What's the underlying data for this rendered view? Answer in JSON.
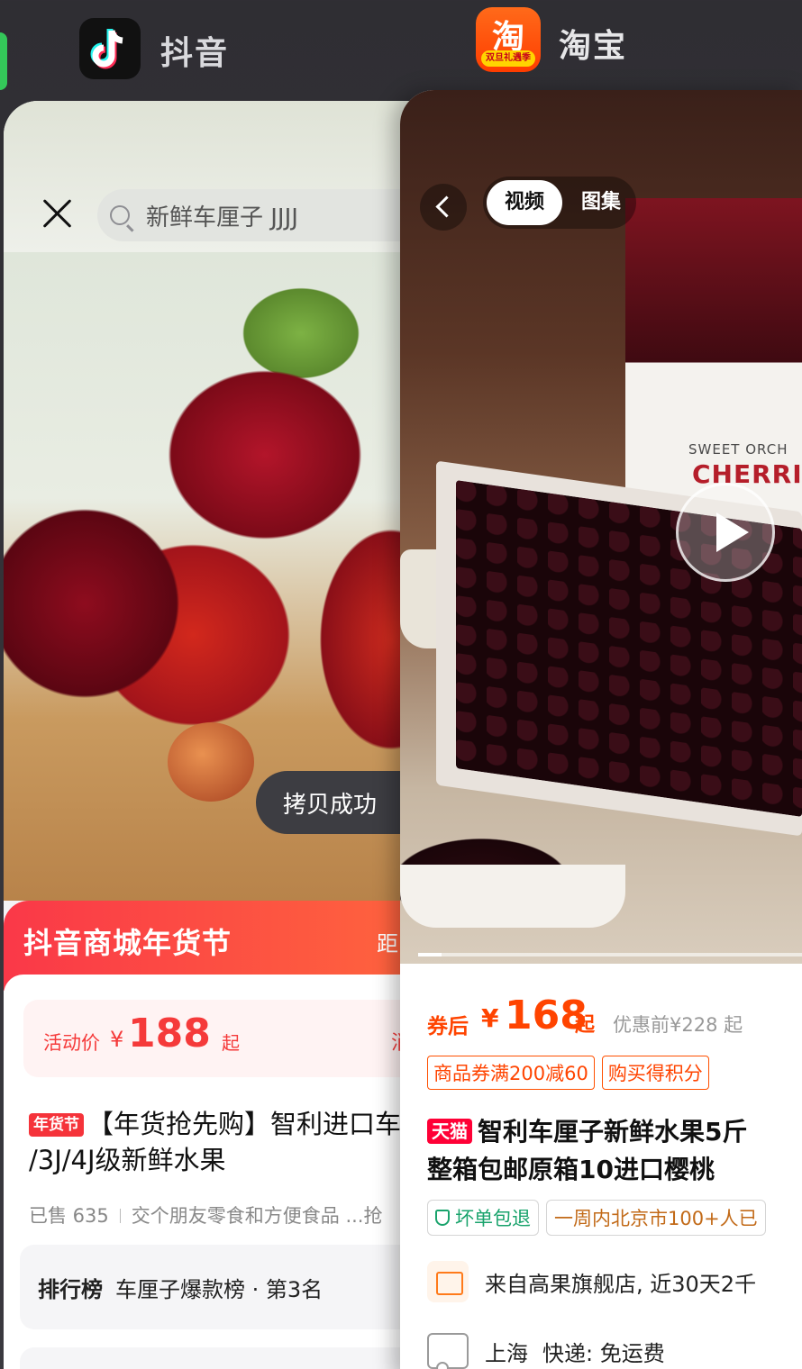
{
  "switcher": {
    "douyin": {
      "name": "抖音",
      "accent": "#fe2c55"
    },
    "taobao": {
      "name": "淘宝",
      "icon_glyph": "淘",
      "icon_sub": "双旦礼遇季",
      "accent": "#ff5000"
    }
  },
  "douyin_card": {
    "search": {
      "query": "新鲜车厘子 JJJJ"
    },
    "toast": "拷贝成功",
    "festival_banner": {
      "title": "抖音商城年货节",
      "right_text": "距"
    },
    "price": {
      "label": "活动价",
      "currency": "¥",
      "amount": "188",
      "suffix": "起",
      "right_text": "消费"
    },
    "product": {
      "tag": "年货节",
      "title_line1": "【年货抢先购】智利进口车",
      "title_line2": "/3J/4J级新鲜水果"
    },
    "sold": {
      "count": "已售 635",
      "shop": "交个朋友零食和方便食品 ...抢"
    },
    "ranking": {
      "badge": "排行榜",
      "text": "车厘子爆款榜 · 第3名"
    }
  },
  "taobao_card": {
    "gallery_tabs": {
      "active": "视频",
      "inactive": "图集"
    },
    "box_text": {
      "line1": "SWEET ORCH",
      "line2": "CHERRI"
    },
    "video_progress": 0.06,
    "price": {
      "after_coupon": "券后",
      "currency": "¥",
      "amount": "168",
      "suffix": "起",
      "original": "优惠前¥228 起"
    },
    "coupons": [
      "商品券满200减60",
      "购买得积分"
    ],
    "product": {
      "tmall_badge": "天猫",
      "title_line1": "智利车厘子新鲜水果5斤",
      "title_line2": "整箱包邮原箱10进口樱桃"
    },
    "guarantees": {
      "return": "坏单包退",
      "popularity": "一周内北京市100+人已"
    },
    "shop": {
      "text": "来自高果旗舰店, 近30天2千"
    },
    "shipping": {
      "origin": "上海",
      "method": "快递: 免运费"
    }
  }
}
